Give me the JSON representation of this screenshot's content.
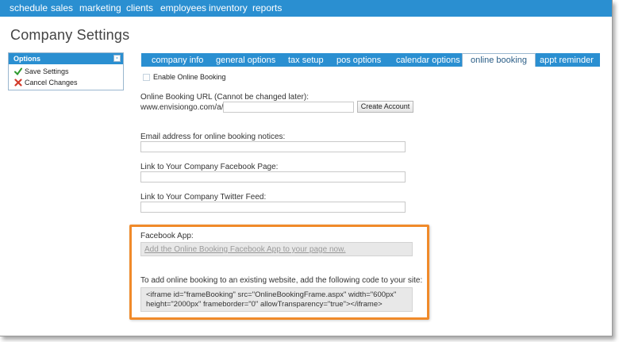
{
  "topnav": {
    "items": [
      "schedule",
      "sales",
      "marketing",
      "clients",
      "employees",
      "inventory",
      "reports"
    ]
  },
  "page": {
    "title": "Company Settings"
  },
  "options_panel": {
    "header": "Options",
    "collapse_glyph": "-",
    "items": [
      {
        "label": "Save Settings",
        "icon": "green-checkmark-icon"
      },
      {
        "label": "Cancel Changes",
        "icon": "red-x-icon"
      }
    ]
  },
  "tabs": {
    "items": [
      "company info",
      "general options",
      "tax setup",
      "pos options",
      "calendar options",
      "online booking",
      "appt reminder"
    ],
    "active": "online booking"
  },
  "form": {
    "enable_label": "Enable Online Booking",
    "enable_checked": false,
    "url_label": "Online Booking URL (Cannot be changed later):",
    "url_prefix": "www.envisiongo.com/a/",
    "url_value": "",
    "create_account_label": "Create Account",
    "email_label": "Email address for online booking notices:",
    "email_value": "",
    "facebook_label": "Link to Your Company Facebook Page:",
    "facebook_value": "",
    "twitter_label": "Link to Your Company Twitter Feed:",
    "twitter_value": ""
  },
  "facebook_app": {
    "label": "Facebook App:",
    "link_text": "Add the Online Booking Facebook App to your page now."
  },
  "embed": {
    "label": "To add online booking to an existing website, add the following code to your site:",
    "code_line1": "<iframe id=\"frameBooking\" src=\"OnlineBookingFrame.aspx\" width=\"600px\"",
    "code_line2": "height=\"2000px\" frameborder=\"0\" allowTransparency=\"true\"></iframe>"
  },
  "colors": {
    "nav_blue": "#2a8fd1",
    "highlight_orange": "#f08a2a"
  }
}
